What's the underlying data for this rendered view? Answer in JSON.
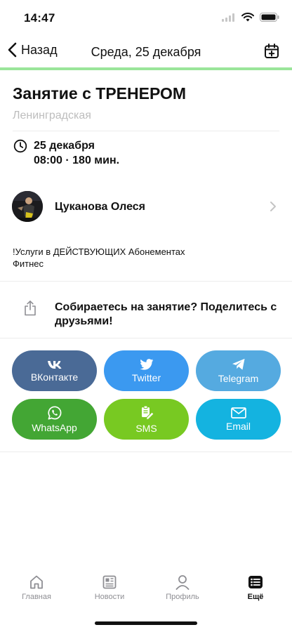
{
  "status_bar": {
    "time": "14:47"
  },
  "nav": {
    "back_label": "Назад",
    "title": "Среда, 25 декабря",
    "calendar_icon": "calendar-plus-icon"
  },
  "colors": {
    "accent_line": "#9be59a",
    "vk": "#4a6a96",
    "twitter": "#3b99f0",
    "telegram": "#55aae0",
    "whatsapp": "#43a634",
    "sms": "#78c922",
    "email": "#14b3e0"
  },
  "lesson": {
    "title": "Занятие с ТРЕНЕРОМ",
    "place": "Ленинградская",
    "date": "25 декабря",
    "time": "08:00 · 180 мин."
  },
  "trainer": {
    "name": "Цуканова Олеся"
  },
  "description": "!Услуги в ДЕЙСТВУЮЩИХ Абонементах\nФитнес",
  "share": {
    "prompt": "Собираетесь на занятие? Поделитесь с друзьями!",
    "buttons": [
      {
        "label": "ВКонтакте",
        "icon": "vk-icon"
      },
      {
        "label": "Twitter",
        "icon": "twitter-icon"
      },
      {
        "label": "Telegram",
        "icon": "telegram-icon"
      },
      {
        "label": "WhatsApp",
        "icon": "whatsapp-icon"
      },
      {
        "label": "SMS",
        "icon": "sms-icon"
      },
      {
        "label": "Email",
        "icon": "email-icon"
      }
    ]
  },
  "tabs": [
    {
      "label": "Главная",
      "icon": "home-icon",
      "active": false
    },
    {
      "label": "Новости",
      "icon": "news-icon",
      "active": false
    },
    {
      "label": "Профиль",
      "icon": "profile-icon",
      "active": false
    },
    {
      "label": "Ещё",
      "icon": "more-icon",
      "active": true
    }
  ]
}
